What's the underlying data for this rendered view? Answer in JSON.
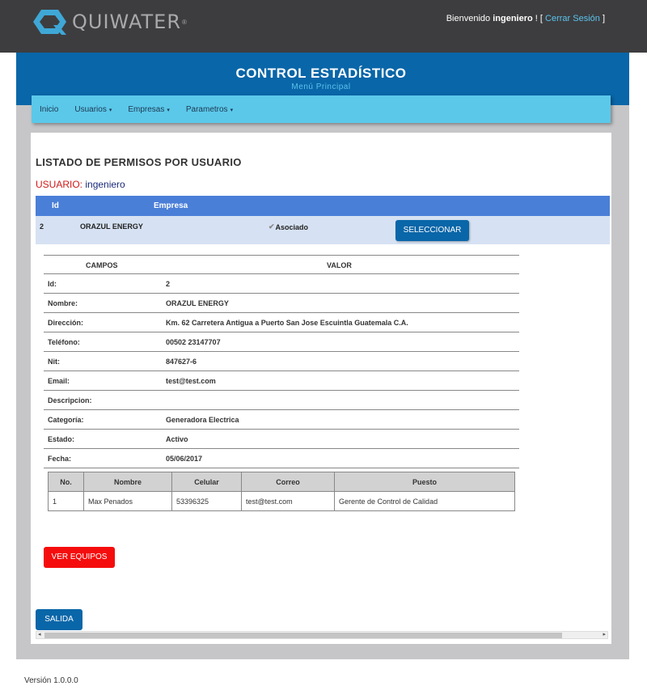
{
  "header": {
    "logo_text": "QUIWATER",
    "logo_mark": "®",
    "welcome_prefix": "Bienvenido",
    "username": "ingeniero",
    "welcome_suffix": "! [",
    "logout_label": "Cerrar Sesión",
    "bracket_close": "]"
  },
  "banner": {
    "title": "CONTROL ESTADÍSTICO",
    "subtitle": "Menú Principal"
  },
  "nav": {
    "items": [
      {
        "label": "Inicio",
        "has_caret": false
      },
      {
        "label": "Usuarios",
        "has_caret": true
      },
      {
        "label": "Empresas",
        "has_caret": true
      },
      {
        "label": "Parametros",
        "has_caret": true
      }
    ],
    "caret": "▾"
  },
  "content": {
    "heading": "LISTADO DE PERMISOS POR USUARIO",
    "user_label": "USUARIO:",
    "user_value": "ingeniero",
    "permissions_table": {
      "headers": [
        "Id",
        "Empresa"
      ],
      "rows": [
        {
          "id": "2",
          "empresa": "ORAZUL ENERGY",
          "asociado_label": "Asociado",
          "checked": true,
          "button": "SELECCIONAR"
        }
      ]
    },
    "detail": {
      "headers": [
        "CAMPOS",
        "VALOR"
      ],
      "rows": [
        {
          "k": "Id:",
          "v": "2"
        },
        {
          "k": "Nombre:",
          "v": "ORAZUL ENERGY"
        },
        {
          "k": "Dirección:",
          "v": "Km. 62 Carretera Antigua a Puerto San Jose Escuintla Guatemala C.A."
        },
        {
          "k": "Teléfono:",
          "v": "00502 23147707"
        },
        {
          "k": "Nit:",
          "v": "847627-6"
        },
        {
          "k": "Email:",
          "v": "test@test.com"
        },
        {
          "k": "Descripcion:",
          "v": ""
        },
        {
          "k": "Categoría:",
          "v": "Generadora Electrica"
        },
        {
          "k": "Estado:",
          "v": "Activo"
        },
        {
          "k": "Fecha:",
          "v": "05/06/2017"
        }
      ]
    },
    "contacts": {
      "headers": [
        "No.",
        "Nombre",
        "Celular",
        "Correo",
        "Puesto"
      ],
      "rows": [
        [
          "1",
          "Max Penados",
          "53396325",
          "test@test.com",
          "Gerente de Control de Calidad"
        ]
      ]
    },
    "ver_equipos_label": "VER EQUIPOS",
    "salida_label": "SALIDA"
  },
  "footer": {
    "version": "Versión 1.0.0.0"
  },
  "colors": {
    "topbar": "#3d3d3f",
    "banner": "#0966a8",
    "navbar": "#5bc8ea",
    "table_header": "#4a7fd8",
    "danger": "#f50d0d"
  }
}
